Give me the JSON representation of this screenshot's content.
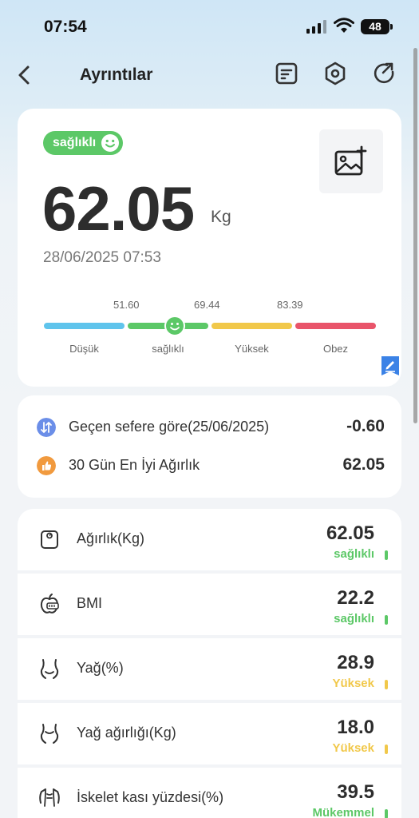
{
  "status": {
    "time": "07:54",
    "battery": "48"
  },
  "nav": {
    "title": "Ayrıntılar"
  },
  "summary": {
    "badge": "sağlıklı",
    "weight": "62.05",
    "unit": "Kg",
    "date": "28/06/2025 07:53",
    "scale": {
      "ticks": [
        "51.60",
        "69.44",
        "83.39"
      ],
      "segments": [
        {
          "label": "Düşük",
          "color": "#5fc4ec"
        },
        {
          "label": "sağlıklı",
          "color": "#5cc867"
        },
        {
          "label": "Yüksek",
          "color": "#f1c84a"
        },
        {
          "label": "Obez",
          "color": "#e9546a"
        }
      ]
    }
  },
  "compare": [
    {
      "label": "Geçen sefere göre(25/06/2025)",
      "value": "-0.60",
      "icon": "compare-icon",
      "color": "#6b8ee8"
    },
    {
      "label": "30 Gün En İyi Ağırlık",
      "value": "62.05",
      "icon": "thumbs-up-icon",
      "color": "#f19a3e"
    }
  ],
  "metrics": [
    {
      "label": "Ağırlık(Kg)",
      "value": "62.05",
      "status": "sağlıklı",
      "color": "#5cc867",
      "icon": "scale-icon"
    },
    {
      "label": "BMI",
      "value": "22.2",
      "status": "sağlıklı",
      "color": "#5cc867",
      "icon": "bmi-apple-icon"
    },
    {
      "label": "Yağ(%)",
      "value": "28.9",
      "status": "Yüksek",
      "color": "#f1c84a",
      "icon": "body-fat-icon"
    },
    {
      "label": "Yağ ağırlığı(Kg)",
      "value": "18.0",
      "status": "Yüksek",
      "color": "#f1c84a",
      "icon": "fat-weight-icon"
    },
    {
      "label": "İskelet kası yüzdesi(%)",
      "value": "39.5",
      "status": "Mükemmel",
      "color": "#5cc867",
      "icon": "muscle-icon"
    }
  ]
}
